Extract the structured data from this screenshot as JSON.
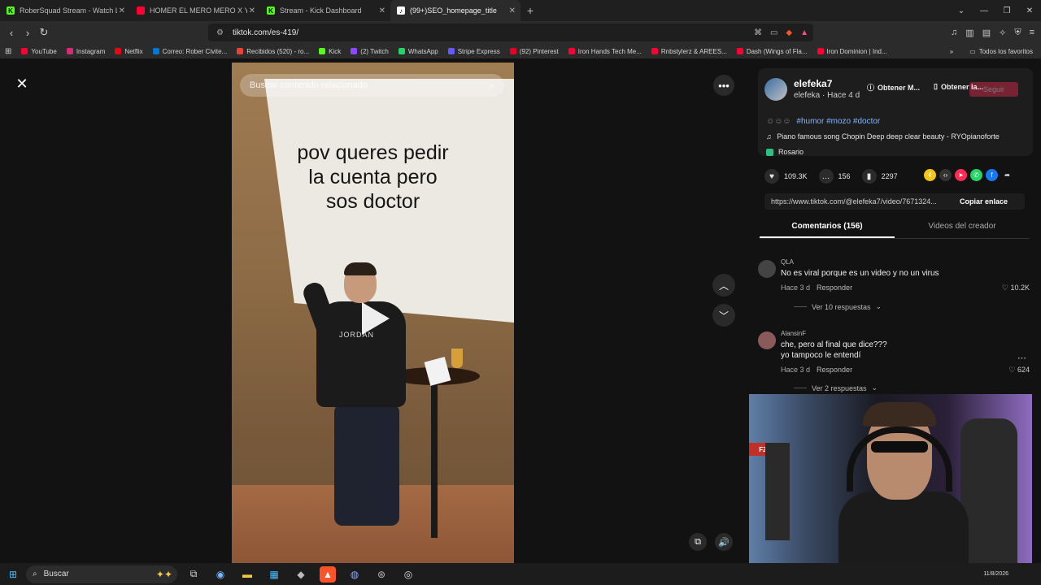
{
  "browser": {
    "tabs": [
      {
        "title": "RoberSquad Stream - Watch Live",
        "icon": "kick-icon",
        "color": "#53fc18"
      },
      {
        "title": "HOMER EL MERO MERO X YSY A - D",
        "icon": "youtube-icon",
        "color": "#ff0033"
      },
      {
        "title": "Stream - Kick Dashboard",
        "icon": "kick-icon",
        "color": "#53fc18"
      },
      {
        "title": "(99+)SEO_homepage_title",
        "icon": "tiktok-icon",
        "color": "#ffffff"
      }
    ],
    "url": "tiktok.com/es-419/",
    "bookmarks": [
      {
        "label": "YouTube",
        "color": "#ff0033"
      },
      {
        "label": "Instagram",
        "color": "#d62976"
      },
      {
        "label": "Netflix",
        "color": "#e50914"
      },
      {
        "label": "Correo: Rober Civite...",
        "color": "#0078d4"
      },
      {
        "label": "Recibidos (520) - ro...",
        "color": "#ea4335"
      },
      {
        "label": "Kick",
        "color": "#53fc18"
      },
      {
        "label": "(2) Twitch",
        "color": "#9146ff"
      },
      {
        "label": "WhatsApp",
        "color": "#25d366"
      },
      {
        "label": "Stripe Express",
        "color": "#635bff"
      },
      {
        "label": "(92) Pinterest",
        "color": "#e60023"
      },
      {
        "label": "Iron Hands Tech Me...",
        "color": "#ff0033"
      },
      {
        "label": "Rnbstylerz & AREES...",
        "color": "#ff0033"
      },
      {
        "label": "Dash (Wings of Fla...",
        "color": "#ff0033"
      },
      {
        "label": "Iron Dominion | Ind...",
        "color": "#ff0033"
      }
    ],
    "bookmarks_all": "Todos los favoritos"
  },
  "video": {
    "search_placeholder": "Buscar contenido relacionado",
    "caption_line1": "pov queres pedir",
    "caption_line2": "la cuenta pero",
    "caption_line3": "sos doctor",
    "shirt_text": "JORDAN"
  },
  "panel": {
    "author_name": "elefeka7",
    "author_sub": "elefeka · Hace 4 d",
    "obtain_btn_1": "Obtener M...",
    "obtain_btn_2": "Obtener la...",
    "follow_label": "Seguir",
    "hashtags": "#humor #mozo #doctor",
    "music": "Piano famous song Chopin Deep deep clear beauty - RYOpianoforte",
    "location": "Rosario",
    "likes": "109.3K",
    "comments_count": "156",
    "saves": "2297",
    "link": "https://www.tiktok.com/@elefeka7/video/7671324...",
    "copy_label": "Copiar enlace",
    "tab_comments": "Comentarios (156)",
    "tab_creator": "Videos del creador",
    "comments": [
      {
        "user": "QLA",
        "text": "No es viral porque es un video y no un virus",
        "time": "Hace 3 d",
        "reply": "Responder",
        "likes": "10.2K",
        "more": "Ver 10 respuestas"
      },
      {
        "user": "AlansinF",
        "text_line1": "che, pero al final que dice???",
        "text_line2": "yo tampoco le entendí",
        "time": "Hace 3 d",
        "reply": "Responder",
        "likes": "624",
        "more": "Ver 2 respuestas"
      }
    ]
  },
  "taskbar": {
    "search_label": "Buscar",
    "clock": "11/8/2026"
  }
}
